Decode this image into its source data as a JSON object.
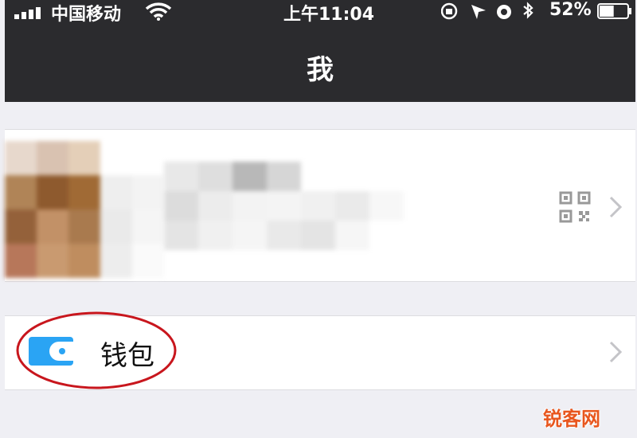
{
  "status_bar": {
    "carrier": "中国移动",
    "time": "上午11:04",
    "battery_percent": "52%",
    "battery_level": 0.52,
    "icons": [
      "signal-icon",
      "wifi-icon",
      "rotation-lock-icon",
      "location-icon",
      "alarm-icon",
      "bluetooth-icon",
      "battery-icon"
    ]
  },
  "nav": {
    "title": "我"
  },
  "profile": {
    "avatar": "pixelated-avatar",
    "name": "",
    "icons": [
      "qr-code-icon",
      "chevron-right-icon"
    ]
  },
  "menu": {
    "wallet_label": "钱包",
    "wallet_icon": "wallet-icon",
    "wallet_icon_color": "#2aa4f4"
  },
  "annotation": {
    "color": "#c8161d"
  },
  "watermark": {
    "text": "锐客网",
    "color": "#e8561e"
  }
}
